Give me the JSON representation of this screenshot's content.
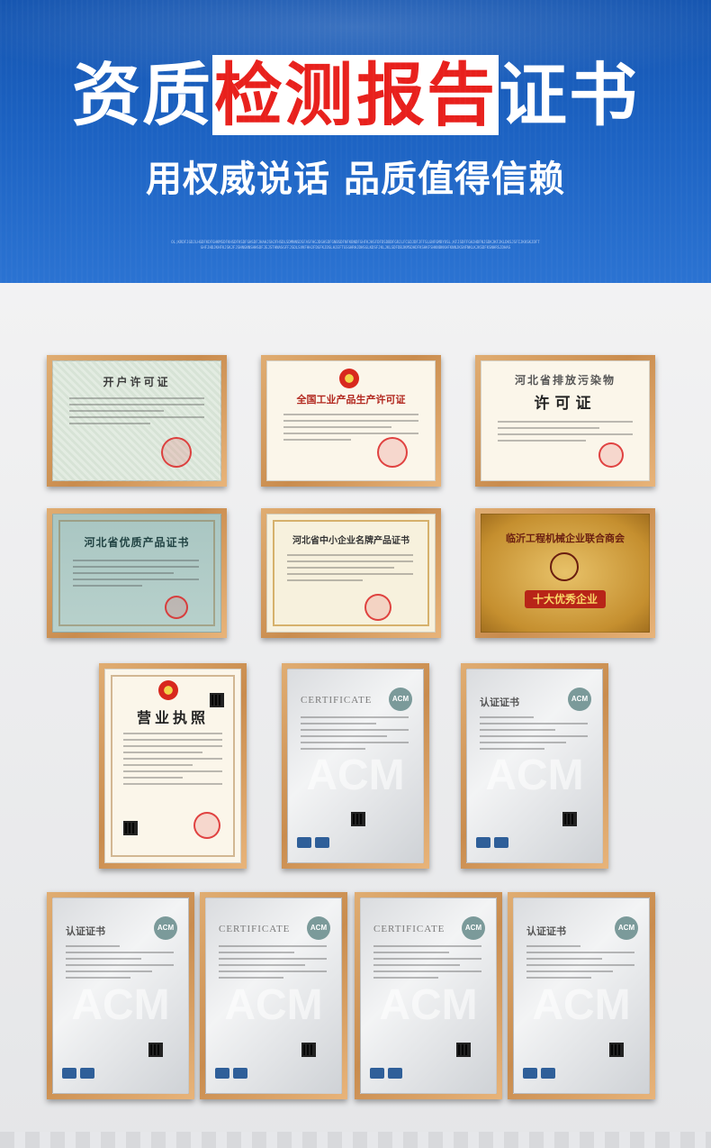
{
  "header": {
    "title_part1": "资质",
    "title_highlight1": "检测",
    "title_highlight2": "报告",
    "title_part2": "证书",
    "subtitle": "用权威说话 品质值得信赖",
    "tagline_noise": "OL;KRDFJGDJLHGDFKDFGHKMSDFKHSDFKSDFGHSDFJHAHJSHJFHSDLSDMNNSDSFASFHGJDGHSDFGNBSDFNFKBNDFGHFKJHSFDFDSDBDFGRJLFCGDJDFJFFSLGNFGMBYOSL;KFJSDFFGHJHDFNJSDKJKFJKLDKSJSFIJKKSKJDFTGHFJHDJKHFKJSKJFJSHNGNNSHHSDFJEJSTHNASGFFJSDLSVKFHHJFDGFKJDSLHJEFTGSGHRHJDHSGLKDSFJKLJKLSDFDBJKMSDHDFKSHKFSHKNBKKHFKNNJKSNFNKLKJKSDFKSNHRSJDHAS"
  },
  "colors": {
    "header_top": "#1555b0",
    "header_bottom": "#2b73d2",
    "highlight_text": "#e8201c",
    "frame_wood": "#d9a066"
  },
  "certificates": [
    {
      "id": "c1",
      "title": "开户许可证",
      "style": "green"
    },
    {
      "id": "c2",
      "title": "全国工业产品生产许可证",
      "style": "cream"
    },
    {
      "id": "c3",
      "title": "河北省排放污染物",
      "subtitle": "许可证",
      "style": "cream"
    },
    {
      "id": "c4",
      "title": "河北省优质产品证书",
      "style": "teal"
    },
    {
      "id": "c5",
      "title": "河北省中小企业名牌产品证书",
      "style": "cream"
    },
    {
      "id": "c6",
      "title": "临沂工程机械企业联合商会",
      "subtitle": "十大优秀企业",
      "style": "gold"
    },
    {
      "id": "c7",
      "title": "营业执照",
      "style": "cream"
    },
    {
      "id": "c8",
      "title": "CERTIFICATE",
      "watermark": "ACM",
      "logo": "ACM",
      "style": "silver"
    },
    {
      "id": "c9",
      "title": "认证证书",
      "watermark": "ACM",
      "logo": "ACM",
      "style": "silver"
    },
    {
      "id": "c10",
      "title": "认证证书",
      "watermark": "ACM",
      "logo": "ACM",
      "style": "silver"
    },
    {
      "id": "c11",
      "title": "CERTIFICATE",
      "watermark": "ACM",
      "logo": "ACM",
      "style": "silver"
    },
    {
      "id": "c12",
      "title": "CERTIFICATE",
      "watermark": "ACM",
      "logo": "ACM",
      "style": "silver"
    },
    {
      "id": "c13",
      "title": "认证证书",
      "watermark": "ACM",
      "logo": "ACM",
      "style": "silver"
    }
  ]
}
